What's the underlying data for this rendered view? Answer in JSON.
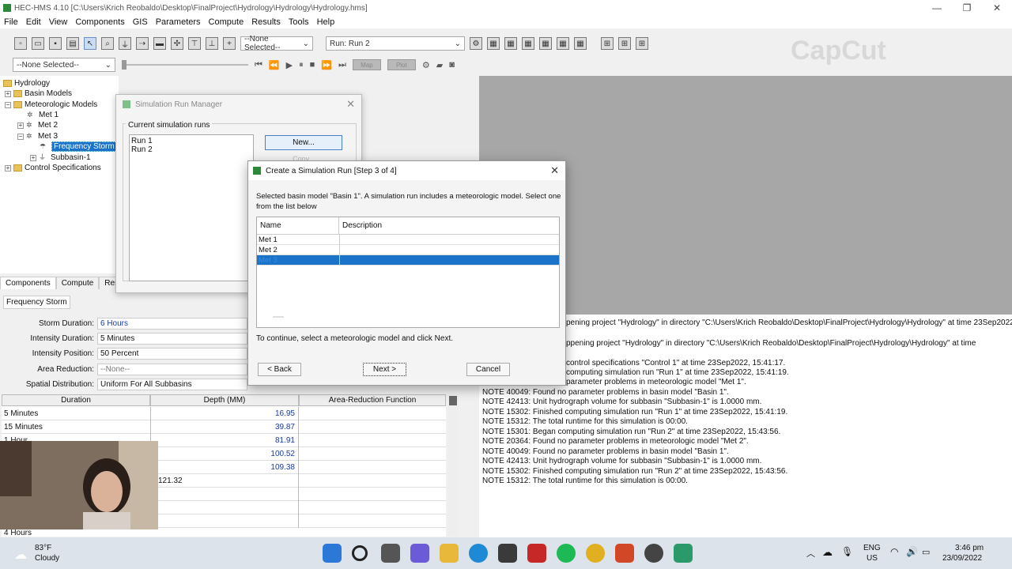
{
  "window": {
    "title": "HEC-HMS 4.10 [C:\\Users\\Krich Reobaldo\\Desktop\\FinalProject\\Hydrology\\Hydrology\\Hydrology.hms]",
    "controls": [
      "—",
      "❐",
      "✕"
    ]
  },
  "menu": [
    "File",
    "Edit",
    "View",
    "Components",
    "GIS",
    "Parameters",
    "Compute",
    "Results",
    "Tools",
    "Help"
  ],
  "toolbar": {
    "selected_combo": "--None Selected--",
    "run_combo": "Run: Run 2",
    "second_combo": "--None Selected--",
    "map_btn": "Map",
    "plot_btn": "Plot"
  },
  "tree": {
    "root": "Hydrology",
    "basin_models": "Basin Models",
    "met_models": "Meteorologic Models",
    "met1": "Met 1",
    "met2": "Met 2",
    "met3": "Met 3",
    "freq_storm": "Frequency Storm",
    "subbasin": "Subbasin-1",
    "control": "Control Specifications"
  },
  "tabs": [
    "Components",
    "Compute",
    "Resul"
  ],
  "params": {
    "tab_label": "Frequency Storm",
    "storm_duration_label": "Storm Duration:",
    "storm_duration": "6 Hours",
    "intensity_duration_label": "Intensity Duration:",
    "intensity_duration": "5 Minutes",
    "intensity_position_label": "Intensity Position:",
    "intensity_position": "50 Percent",
    "area_reduction_label": "Area Reduction:",
    "area_reduction": "--None--",
    "spatial_dist_label": "Spatial Distribution:",
    "spatial_dist": "Uniform For All Subbasins"
  },
  "grid": {
    "headers": [
      "Duration",
      "Depth (MM)",
      "Area-Reduction Function"
    ],
    "rows": [
      {
        "duration": "5 Minutes",
        "depth": "16.95"
      },
      {
        "duration": "15 Minutes",
        "depth": "39.87"
      },
      {
        "duration": "1 Hour",
        "depth": "81.91"
      },
      {
        "duration": "",
        "depth": "100.52"
      },
      {
        "duration": "",
        "depth": "109.38"
      },
      {
        "duration": "",
        "depth": "121.32"
      }
    ],
    "last_row": "4 Hours"
  },
  "log": [
    "pening project \"Hydrology\" in directory \"C:\\Users\\Krich Reobaldo\\Desktop\\FinalProject\\Hydrology\\Hydrology\" at time 23Sep2022,",
    "ppening project \"Hydrology\" in directory \"C:\\Users\\Krich Reobaldo\\Desktop\\FinalProject\\Hydrology\\Hydrology\" at time",
    "control specifications \"Control 1\" at time 23Sep2022, 15:41:17.",
    "computing simulation run \"Run 1\" at time 23Sep2022, 15:41:19.",
    "parameter problems in meteorologic model \"Met 1\".",
    "NOTE 40049:  Found no parameter problems in basin model \"Basin 1\".",
    "NOTE 42413:  Unit hydrograph volume for subbasin \"Subbasin-1\" is 1.0000 mm.",
    "NOTE 15302:  Finished computing simulation run \"Run 1\" at time 23Sep2022, 15:41:19.",
    "NOTE 15312:  The total runtime for this simulation is 00:00.",
    "NOTE 15301:  Began computing simulation run \"Run 2\" at time 23Sep2022, 15:43:56.",
    "NOTE 20364:  Found no parameter problems in meteorologic model \"Met 2\".",
    "NOTE 40049:  Found no parameter problems in basin model \"Basin 1\".",
    "NOTE 42413:  Unit hydrograph volume for subbasin \"Subbasin-1\" is 1.0000 mm.",
    "NOTE 15302:  Finished computing simulation run \"Run 2\" at time 23Sep2022, 15:43:56.",
    "NOTE 15312:  The total runtime for this simulation is 00:00."
  ],
  "srm": {
    "title": "Simulation Run Manager",
    "group": "Current simulation runs",
    "runs": [
      "Run 1",
      "Run 2"
    ],
    "new_btn": "New...",
    "copy_btn": "Copy..."
  },
  "csr": {
    "title": "Create a Simulation Run [Step 3 of 4]",
    "desc": "Selected basin model \"Basin 1\". A simulation run includes a meteorologic model. Select one from the list below",
    "col_name": "Name",
    "col_desc": "Description",
    "items": [
      "Met 1",
      "Met 2",
      "Met 3"
    ],
    "hint": "To continue, select a meteorologic model and click Next.",
    "back": "< Back",
    "next": "Next >",
    "cancel": "Cancel"
  },
  "watermark": "CapCut",
  "taskbar": {
    "temp": "83°F",
    "weather": "Cloudy",
    "lang1": "ENG",
    "lang2": "US",
    "time": "3:46 pm",
    "date": "23/09/2022"
  }
}
